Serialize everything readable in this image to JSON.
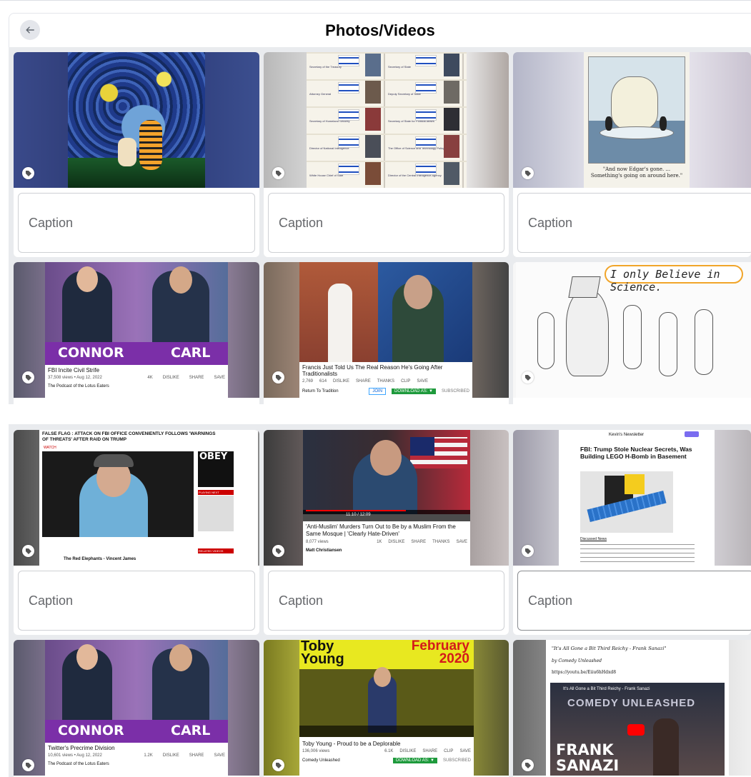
{
  "header": {
    "title": "Photos/Videos",
    "back_icon": "arrow-left-icon"
  },
  "caption_placeholder": "Caption",
  "items": [
    {
      "id": "p1",
      "alt": "Starry night painting with boy and tiger"
    },
    {
      "id": "p2",
      "alt": "Grid of officials with Israeli flags",
      "labels": [
        "Secretary of the Treasury",
        "Secretary of State",
        "Attorney General",
        "Deputy Secretary of State",
        "Secretary of Homeland Security",
        "Secretary of State for Political Affairs",
        "Director of National Intelligence",
        "The Office of Science and Technology Policy",
        "White House Chief of Staff",
        "Director of the Central Intelligence Agency"
      ]
    },
    {
      "id": "p3",
      "alt": "Polar bear cartoon",
      "caption": "\"And now Edgar's gone. ... Something's going on around here.\""
    },
    {
      "id": "v1",
      "alt": "Two hosts video",
      "left": "CONNOR",
      "right": "CARL",
      "title": "FBI Incite Civil Strife",
      "meta": "37,508 views • Aug 12, 2022",
      "likes": "4K",
      "channel": "The Podcast of the Lotus Eaters"
    },
    {
      "id": "v2",
      "alt": "Man speaking with pope image",
      "title": "Francis Just Told Us The Real Reason He's Going After Traditionalists",
      "meta": "2,769",
      "likes": "614",
      "channel": "Return To Tradition"
    },
    {
      "id": "p4",
      "alt": "Chameleon cartoon",
      "speech": "I only Believe in Science."
    },
    {
      "id": "v3",
      "alt": "Man with headset",
      "headline": "FALSE FLAG : ATTACK ON FBI OFFICE CONVENIENTLY FOLLOWS 'WARNINGS OF THREATS' AFTER RAID ON TRUMP",
      "watch": "WATCH",
      "obey": "OBEY",
      "channel": "The Red Elephants - Vincent James",
      "playing": "PLAYING NEXT",
      "related": "RELATED VIDEOS"
    },
    {
      "id": "v4",
      "alt": "Man pointing at camera",
      "title": "'Anti-Muslim' Murders Turn Out to Be by a Muslim From the Same Mosque | 'Clearly Hate-Driven'",
      "meta": "8,077 views",
      "likes": "1K",
      "channel": "Matt Christiansen",
      "time": "11:10 / 12:09"
    },
    {
      "id": "p5",
      "alt": "Newsletter page",
      "site": "Kevin's Newsletter",
      "headline": "FBI: Trump Stole Nuclear Secrets, Was Building LEGO H-Bomb in Basement",
      "section": "Discussed News"
    },
    {
      "id": "v5",
      "alt": "Two hosts video",
      "left": "CONNOR",
      "right": "CARL",
      "title": "Twitter's Precrime Division",
      "meta": "10,601 views • Aug 12, 2022",
      "likes": "1.2K",
      "channel": "The Podcast of the Lotus Eaters"
    },
    {
      "id": "v6",
      "alt": "Toby Young comedy",
      "top": "Toby Young",
      "month": "February 2020",
      "title": "Toby Young - Proud to be a Deplorable",
      "meta": "136,006 views",
      "likes": "6.1K",
      "channel": "Comedy Unleashed"
    },
    {
      "id": "p6",
      "alt": "Frank Sanazi video post",
      "line1": "\"It's All Gone a Bit Third Reichy - Frank Sanazi\"",
      "line2": "by Comedy Unleashed",
      "line3": "https://youtu.be/Eiiu6hHdxd8",
      "vtitle": "It's All Gone a Bit Third Reichy - Frank Sanazi",
      "name1": "FRANK",
      "name2": "SANAZI",
      "brand": "COMEDY UNLEASHED"
    }
  ],
  "video_actions": {
    "dislike": "DISLIKE",
    "share": "SHARE",
    "thanks": "THANKS",
    "clip": "CLIP",
    "save": "SAVE",
    "join": "JOIN",
    "download": "DOWNLOAD AS: ▼",
    "subscribed": "SUBSCRIBED"
  }
}
